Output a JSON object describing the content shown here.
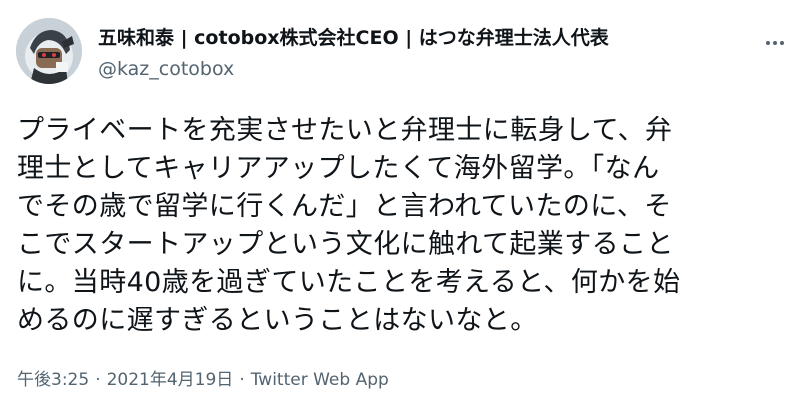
{
  "author": {
    "name": "五味和泰 | cotobox株式会社CEO | はつな弁理士法人代表",
    "handle": "@kaz_cotobox",
    "avatar_icon": "robot-avatar"
  },
  "actions": {
    "more_icon": "more-horizontal-icon"
  },
  "tweet": {
    "lines": [
      "プライベートを充実させたいと弁理士に転身して、弁",
      "理士としてキャリアアップしたくて海外留学。「なん",
      "でその歳で留学に行くんだ」と言われていたのに、そ",
      "こでスタートアップという文化に触れて起業すること",
      "に。当時40歳を過ぎていたことを考えると、何かを始",
      "めるのに遅すぎるということはないなと。"
    ]
  },
  "meta": {
    "time": "午後3:25",
    "separator": "·",
    "date": "2021年4月19日",
    "source": "Twitter Web App"
  },
  "colors": {
    "text": "#0f1419",
    "secondary": "#536471"
  }
}
